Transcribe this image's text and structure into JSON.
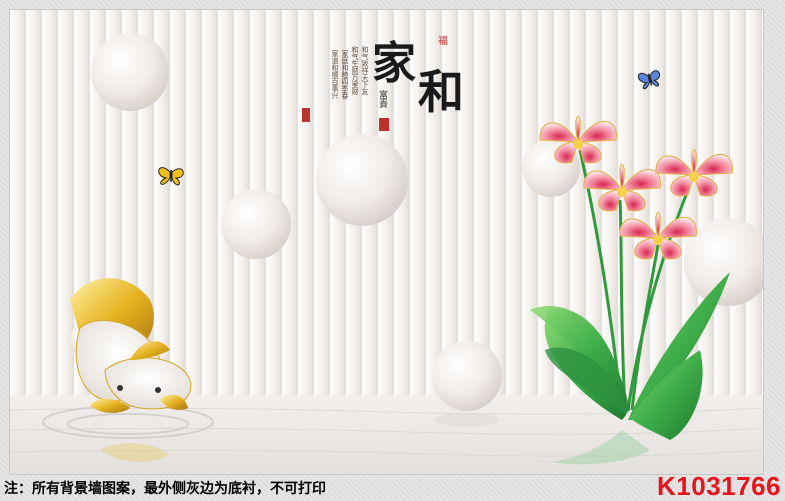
{
  "artwork": {
    "title_calligraphy": [
      "家",
      "和"
    ],
    "seal_top": "福",
    "subtitle": "富貴",
    "poem_lines": [
      "和气致祥天下友",
      "和气生财万里财",
      "家庭和睦四季春",
      "家道和顺百事兴"
    ],
    "colors": {
      "flower_pink": "#e0506a",
      "leaf_green": "#3fae4a",
      "gold": "#e5b320",
      "wall_base": "#f3efec"
    }
  },
  "footer": {
    "note": "注：所有背景墙图案，最外侧灰边为底衬，不可打印",
    "product_code": "K1031766"
  }
}
